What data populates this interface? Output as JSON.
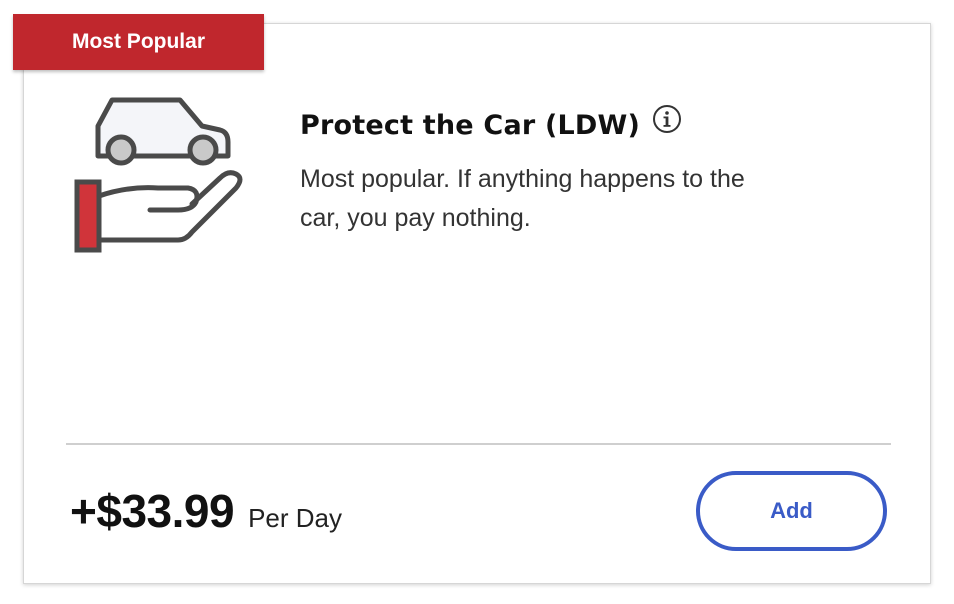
{
  "badge": {
    "label": "Most Popular"
  },
  "product": {
    "illustration_icon": "car-protection-hand-icon",
    "title": "Protect the Car (LDW)",
    "info_icon": "info-circle-icon",
    "description": "Most popular. If anything happens to the car, you pay nothing."
  },
  "pricing": {
    "price": "+$33.99",
    "unit": "Per Day"
  },
  "actions": {
    "add_label": "Add"
  },
  "colors": {
    "badge_red": "#c0272d",
    "accent_blue": "#3a5bc7",
    "text_dark": "#111111"
  }
}
